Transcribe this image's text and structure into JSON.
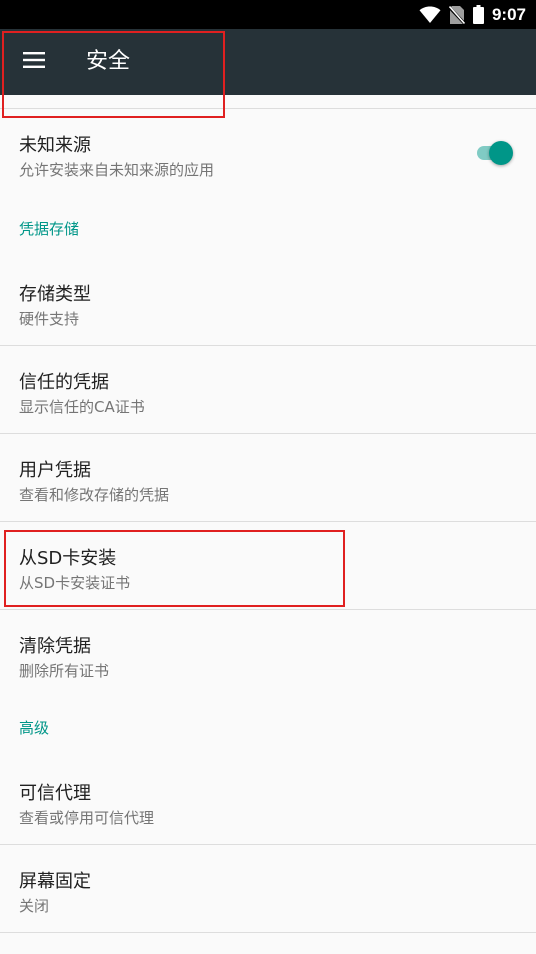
{
  "status_bar": {
    "time": "9:07",
    "icons": [
      "wifi-icon",
      "no-sim-icon",
      "battery-icon"
    ]
  },
  "app_bar": {
    "menu_icon": "hamburger-menu-icon",
    "title": "安全"
  },
  "preferences": {
    "unknown_sources": {
      "title": "未知来源",
      "summary": "允许安装来自未知来源的应用",
      "switch_on": true
    },
    "category_credential_storage": "凭据存储",
    "storage_type": {
      "title": "存储类型",
      "summary": "硬件支持"
    },
    "trusted_credentials": {
      "title": "信任的凭据",
      "summary": "显示信任的CA证书"
    },
    "user_credentials": {
      "title": "用户凭据",
      "summary": "查看和修改存储的凭据"
    },
    "install_from_sd": {
      "title": "从SD卡安装",
      "summary": "从SD卡安装证书"
    },
    "clear_credentials": {
      "title": "清除凭据",
      "summary": "删除所有证书"
    },
    "category_advanced": "高级",
    "trust_agents": {
      "title": "可信代理",
      "summary": "查看或停用可信代理"
    },
    "screen_pinning": {
      "title": "屏幕固定",
      "summary": "关闭"
    }
  },
  "colors": {
    "app_bar": "#263238",
    "accent": "#009688",
    "switch_track": "#80cbc4",
    "highlight": "#e02020"
  }
}
